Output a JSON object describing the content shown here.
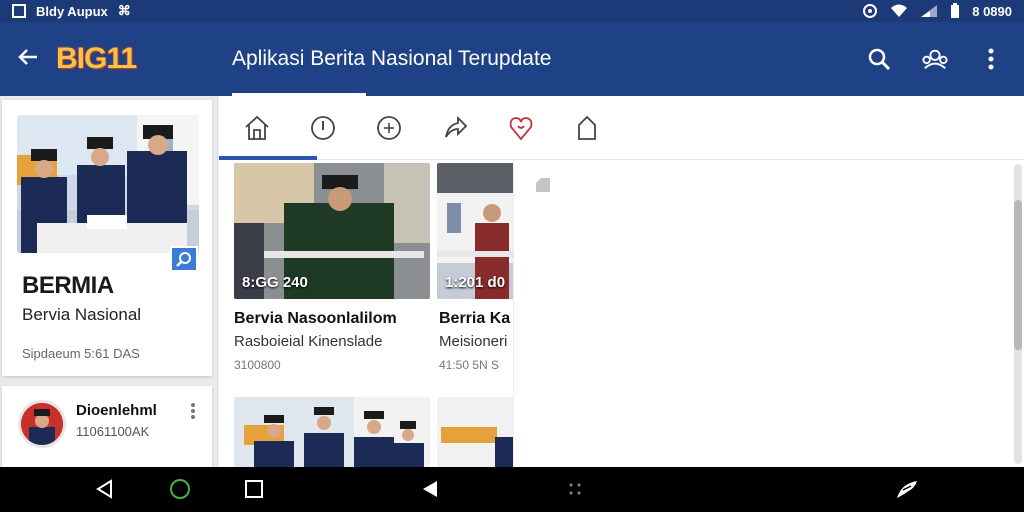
{
  "status_bar": {
    "left_text": "Bldy Aupux",
    "left_glyph": "⌘",
    "right_text": "8 0890"
  },
  "app_bar": {
    "logo": "BIG11",
    "title": "Aplikasi Berita Nasional Terupdate"
  },
  "sidebar": {
    "featured": {
      "heading": "BERMIA",
      "subtitle": "Bervia Nasional",
      "time": "Sipdaeum 5:61 DAS"
    },
    "comment": {
      "name": "Dioenlehml",
      "meta": "11061100AK"
    }
  },
  "feed": {
    "items": [
      {
        "stamp": "8:GG 240",
        "title": "Bervia Nasoonlalilom",
        "subtitle": "Rasboieial Kinenslade",
        "time": "3100800"
      },
      {
        "stamp": "1:201 d0",
        "title": "Berria Ka",
        "subtitle": "Meisioneri",
        "time": "41:50 5N S"
      }
    ]
  },
  "colors": {
    "status_bar": "#1c3a78",
    "app_bar": "#1f4287",
    "accent": "#2a55a8",
    "logo": "#f6c445",
    "nav_bar": "#000000"
  },
  "icons": {
    "tabs": [
      "home-icon",
      "clock-icon",
      "add-circle-icon",
      "share-icon",
      "heart-pin-icon",
      "bookmark-icon"
    ],
    "actions": [
      "search-icon",
      "group-icon",
      "more-vert-icon"
    ],
    "nav": [
      "back-icon",
      "home-circle-icon",
      "recents-icon",
      "play-icon",
      "dots-icon",
      "feather-icon"
    ]
  }
}
